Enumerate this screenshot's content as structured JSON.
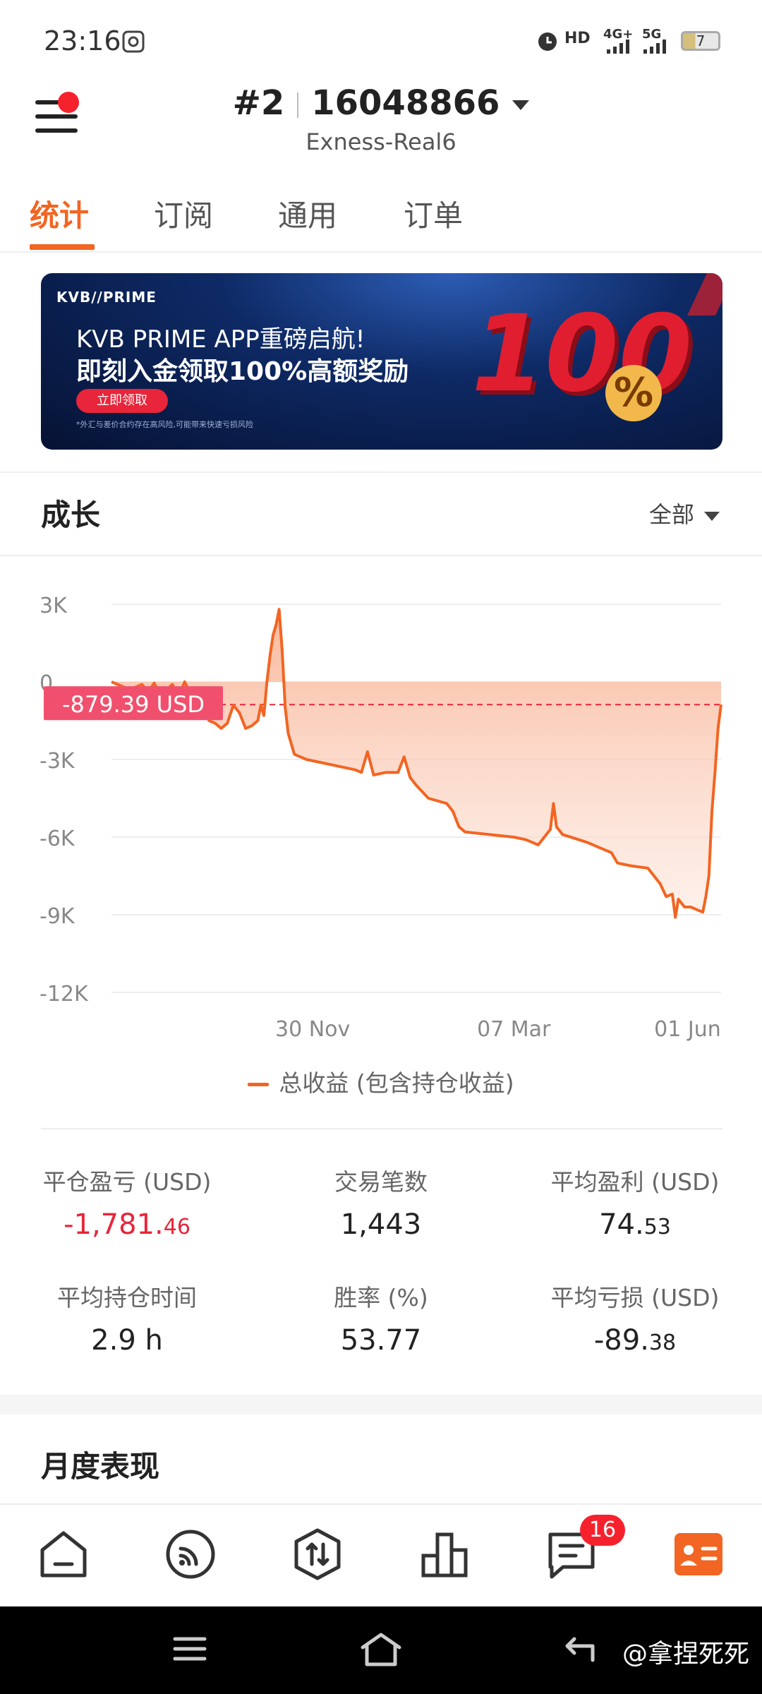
{
  "status": {
    "time": "23:16",
    "battery": "7",
    "signal_labels": [
      "HD",
      "4G+",
      "5G"
    ]
  },
  "header": {
    "account_index": "#2",
    "account_number": "16048866",
    "server": "Exness-Real6"
  },
  "tabs": [
    {
      "label": "统计",
      "active": true
    },
    {
      "label": "订阅",
      "active": false
    },
    {
      "label": "通用",
      "active": false
    },
    {
      "label": "订单",
      "active": false
    }
  ],
  "banner": {
    "logo": "KVB//PRIME",
    "line1": "KVB PRIME APP重磅启航!",
    "line2": "即刻入金领取100%高额奖励",
    "button": "立即领取",
    "fine_print": "*外汇与差价合约存在高风险,可能带来快速亏损风险",
    "big_number": "100",
    "percent": "%"
  },
  "growth": {
    "title": "成长",
    "filter": "全部",
    "current_label": "-879.39 USD",
    "legend": "总收益 (包含持仓收益)"
  },
  "chart_data": {
    "type": "area",
    "ylim": [
      -12000,
      3000
    ],
    "yticks": [
      "3K",
      "0",
      "-3K",
      "-6K",
      "-9K",
      "-12K"
    ],
    "ytick_values": [
      3000,
      0,
      -3000,
      -6000,
      -9000,
      -12000
    ],
    "xticks": [
      "30 Nov",
      "07 Mar",
      "01 Jun"
    ],
    "reference_line": -879.39,
    "series": [
      {
        "name": "总收益 (包含持仓收益)",
        "color": "#f26522",
        "points": [
          [
            0,
            0
          ],
          [
            0.03,
            -300
          ],
          [
            0.05,
            -100
          ],
          [
            0.06,
            -400
          ],
          [
            0.07,
            -50
          ],
          [
            0.08,
            -500
          ],
          [
            0.1,
            -100
          ],
          [
            0.11,
            -600
          ],
          [
            0.12,
            0
          ],
          [
            0.13,
            -500
          ],
          [
            0.15,
            -1000
          ],
          [
            0.16,
            -1500
          ],
          [
            0.17,
            -1600
          ],
          [
            0.18,
            -1800
          ],
          [
            0.19,
            -1600
          ],
          [
            0.2,
            -900
          ],
          [
            0.21,
            -1200
          ],
          [
            0.22,
            -1800
          ],
          [
            0.23,
            -1700
          ],
          [
            0.24,
            -1500
          ],
          [
            0.245,
            -900
          ],
          [
            0.25,
            -1300
          ],
          [
            0.255,
            0
          ],
          [
            0.26,
            1000
          ],
          [
            0.265,
            1800
          ],
          [
            0.27,
            2200
          ],
          [
            0.275,
            2800
          ],
          [
            0.28,
            1200
          ],
          [
            0.285,
            -1000
          ],
          [
            0.29,
            -2000
          ],
          [
            0.3,
            -2800
          ],
          [
            0.32,
            -3000
          ],
          [
            0.36,
            -3200
          ],
          [
            0.4,
            -3400
          ],
          [
            0.41,
            -3500
          ],
          [
            0.42,
            -2700
          ],
          [
            0.43,
            -3600
          ],
          [
            0.45,
            -3500
          ],
          [
            0.47,
            -3500
          ],
          [
            0.48,
            -2900
          ],
          [
            0.49,
            -3700
          ],
          [
            0.5,
            -4000
          ],
          [
            0.52,
            -4500
          ],
          [
            0.55,
            -4700
          ],
          [
            0.56,
            -5000
          ],
          [
            0.57,
            -5600
          ],
          [
            0.58,
            -5800
          ],
          [
            0.62,
            -5900
          ],
          [
            0.66,
            -6000
          ],
          [
            0.68,
            -6100
          ],
          [
            0.7,
            -6300
          ],
          [
            0.72,
            -5700
          ],
          [
            0.725,
            -4700
          ],
          [
            0.73,
            -5600
          ],
          [
            0.74,
            -5900
          ],
          [
            0.78,
            -6200
          ],
          [
            0.8,
            -6400
          ],
          [
            0.82,
            -6600
          ],
          [
            0.83,
            -7000
          ],
          [
            0.85,
            -7100
          ],
          [
            0.88,
            -7200
          ],
          [
            0.89,
            -7500
          ],
          [
            0.9,
            -7800
          ],
          [
            0.91,
            -8300
          ],
          [
            0.92,
            -8200
          ],
          [
            0.925,
            -9100
          ],
          [
            0.93,
            -8400
          ],
          [
            0.94,
            -8700
          ],
          [
            0.95,
            -8700
          ],
          [
            0.96,
            -8800
          ],
          [
            0.97,
            -8900
          ],
          [
            0.975,
            -8300
          ],
          [
            0.98,
            -7500
          ],
          [
            0.985,
            -5000
          ],
          [
            0.99,
            -3500
          ],
          [
            0.995,
            -1800
          ],
          [
            1.0,
            -879.39
          ]
        ]
      }
    ]
  },
  "stats": [
    {
      "label": "平仓盈亏 (USD)",
      "int": "-1,781.",
      "dec": "46",
      "negative": true
    },
    {
      "label": "交易笔数",
      "int": "1,443",
      "dec": "",
      "negative": false
    },
    {
      "label": "平均盈利 (USD)",
      "int": "74.",
      "dec": "53",
      "negative": false
    },
    {
      "label": "平均持仓时间",
      "int": "2.9 h",
      "dec": "",
      "negative": false
    },
    {
      "label": "胜率 (%)",
      "int": "53.77",
      "dec": "",
      "negative": false
    },
    {
      "label": "平均亏损 (USD)",
      "int": "-89.",
      "dec": "38",
      "negative": false
    }
  ],
  "monthly": {
    "title": "月度表现"
  },
  "bottom_nav": {
    "items": [
      "home-icon",
      "feed-icon",
      "trade-icon",
      "chart-icon",
      "message-icon",
      "profile-icon"
    ],
    "message_badge": "16",
    "active_color": "#f26522"
  },
  "watermark": "@拿捏死死"
}
